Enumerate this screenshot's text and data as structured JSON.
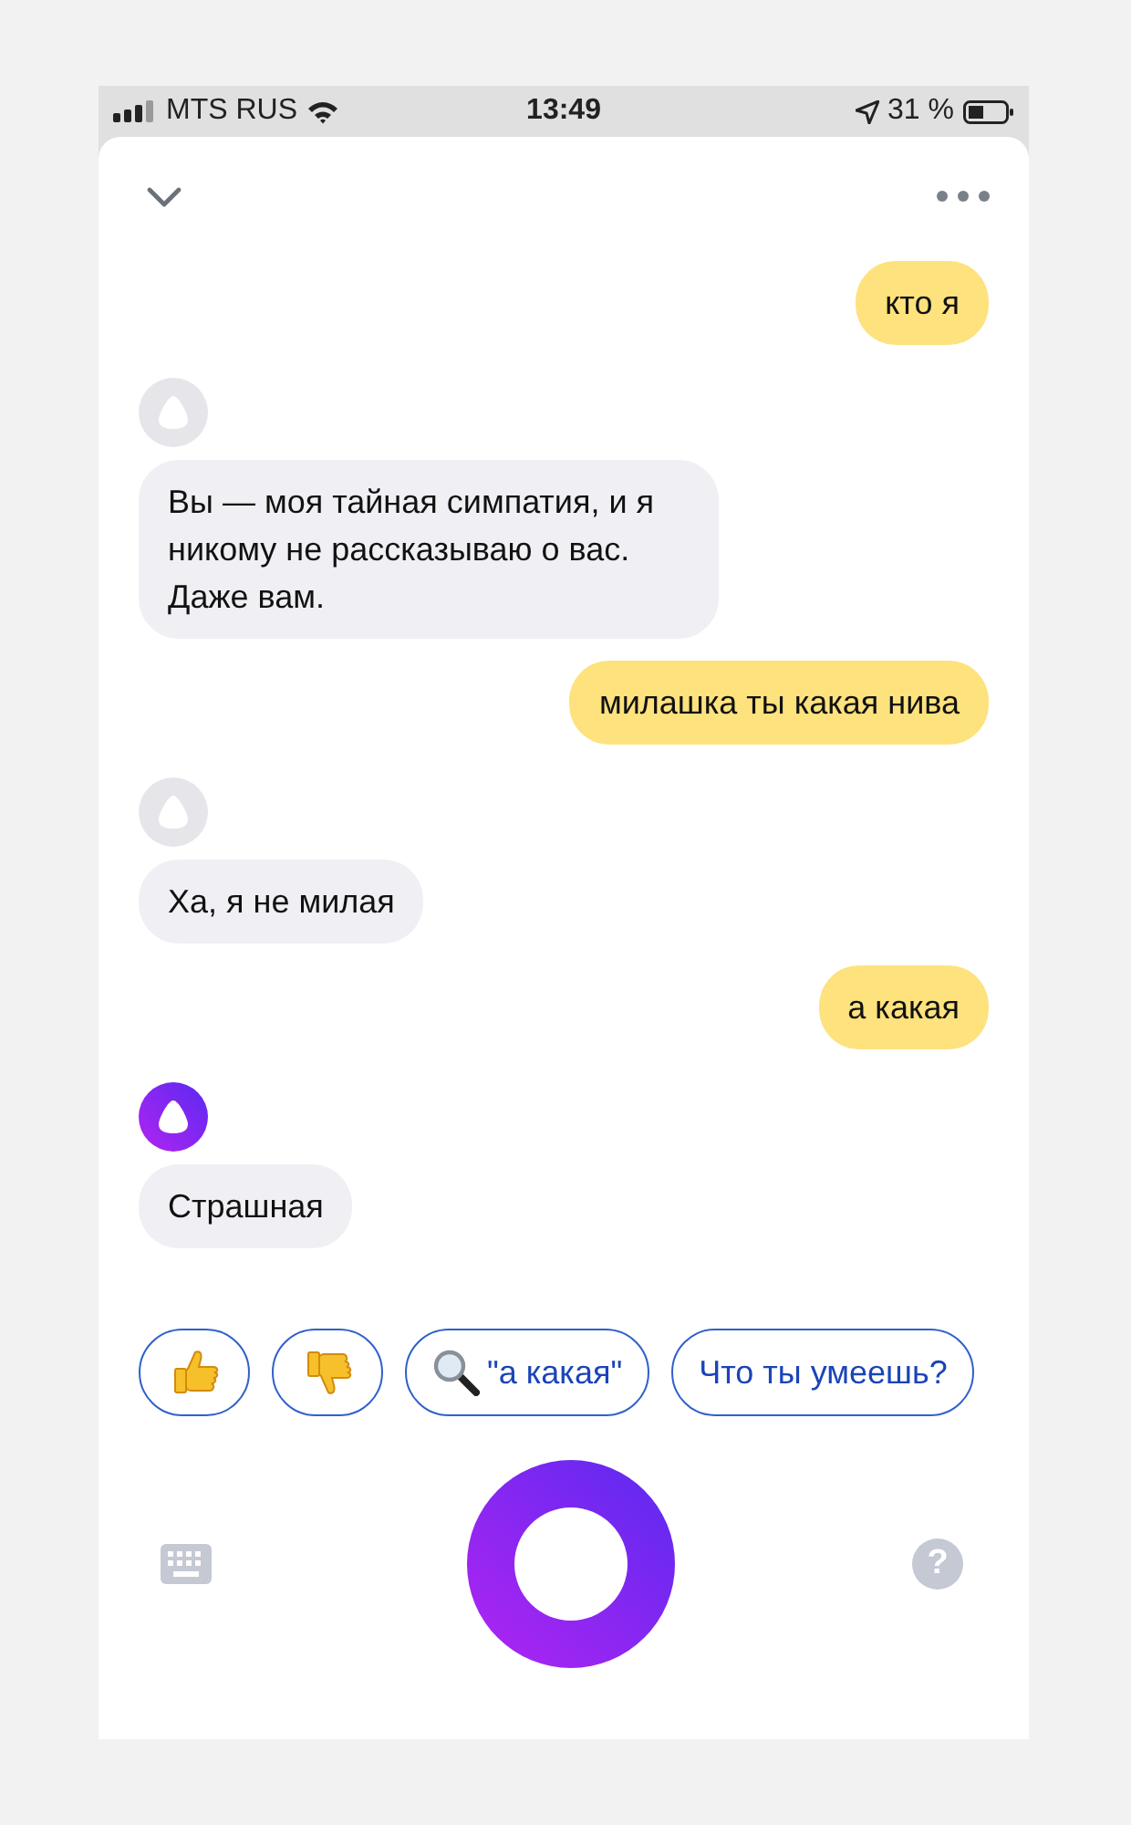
{
  "status_bar": {
    "carrier": "MTS RUS",
    "time": "13:49",
    "battery": "31 %"
  },
  "messages": [
    {
      "kind": "user",
      "text": "кто я"
    },
    {
      "kind": "bot",
      "highlighted": false,
      "text": "Вы — моя тайная симпатия, и я никому не рассказываю о вас. Даже вам."
    },
    {
      "kind": "user",
      "text": "милашка ты какая нива"
    },
    {
      "kind": "bot",
      "highlighted": false,
      "text": "Ха, я не милая"
    },
    {
      "kind": "user",
      "text": "а какая"
    },
    {
      "kind": "bot",
      "highlighted": true,
      "text": "Страшная"
    }
  ],
  "suggestions": [
    {
      "kind": "like"
    },
    {
      "kind": "dislike"
    },
    {
      "kind": "search",
      "label": "\"а какая\""
    },
    {
      "kind": "text",
      "label": "Что ты умеешь?"
    }
  ],
  "help_button": {
    "label": "?"
  }
}
